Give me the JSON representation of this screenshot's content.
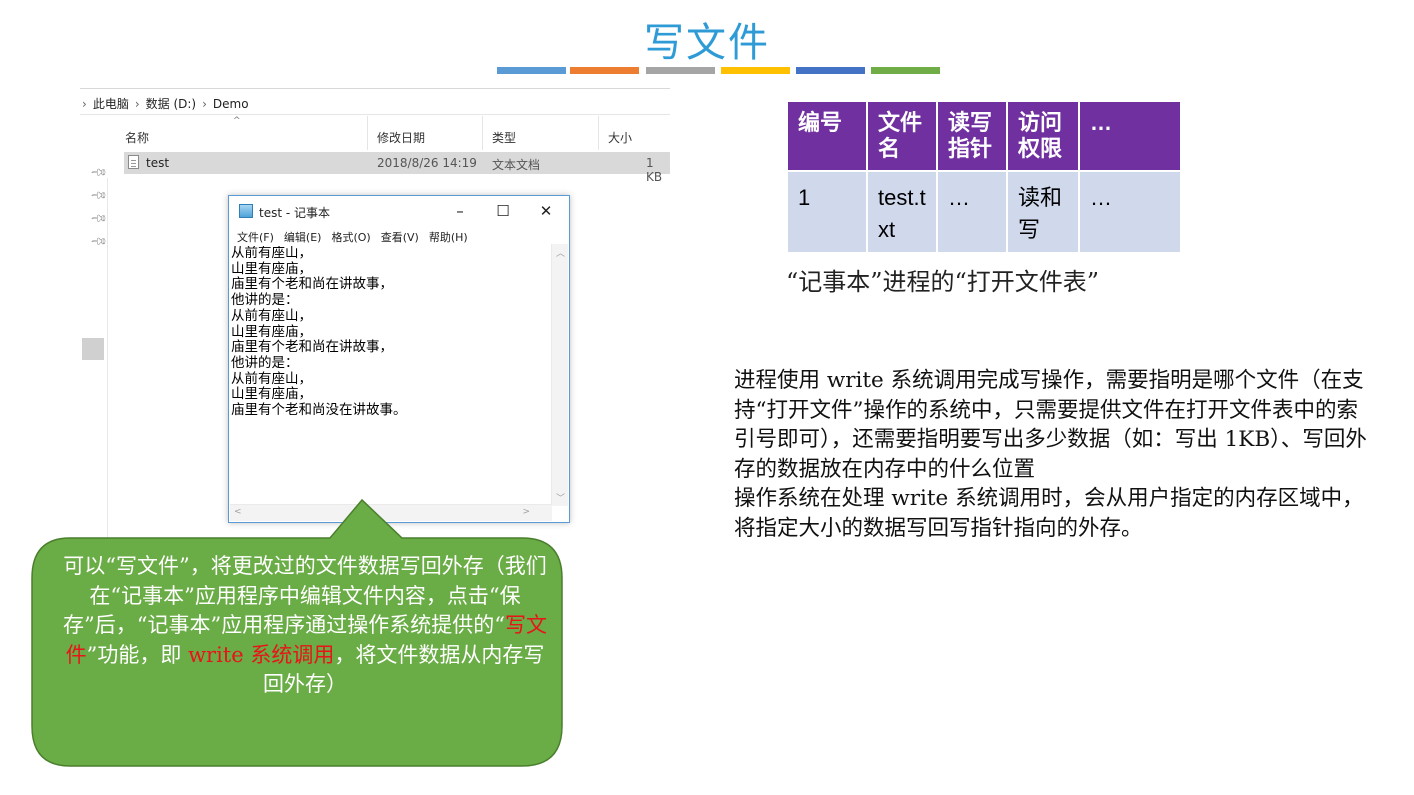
{
  "slide": {
    "title": "写文件",
    "deco_colors": [
      "#5b9bd5",
      "#ed7d31",
      "#a5a5a5",
      "#ffc000",
      "#4472c4",
      "#70ad47"
    ]
  },
  "explorer": {
    "breadcrumb": [
      "此电脑",
      "数据 (D:)",
      "Demo"
    ],
    "columns": {
      "name": "名称",
      "modified": "修改日期",
      "type": "类型",
      "size": "大小"
    },
    "file": {
      "name": "test",
      "modified": "2018/8/26 14:19",
      "type": "文本文档",
      "size": "1 KB"
    }
  },
  "notepad": {
    "title": "test - 记事本",
    "menu": [
      "文件(F)",
      "编辑(E)",
      "格式(O)",
      "查看(V)",
      "帮助(H)"
    ],
    "content": "从前有座山，\n山里有座庙，\n庙里有个老和尚在讲故事，\n他讲的是：\n从前有座山，\n山里有座庙，\n庙里有个老和尚在讲故事，\n他讲的是：\n从前有座山，\n山里有座庙，\n庙里有个老和尚没在讲故事。"
  },
  "callout": {
    "part1": "可以“写文件”，将更改过的文件数据写回外存（我们在“记事本”应用程序中编辑文件内容，点击“保存”后，“记事本”应用程序通过操作系统提供的“",
    "highlight1": "写文件",
    "part2": "”功能，即 ",
    "highlight2": "write 系统调用",
    "part3": "，将文件数据从内存写回外存）",
    "fill_color": "#6aac45",
    "highlight_color": "#e8141a"
  },
  "open_file_table": {
    "headers": [
      "编号",
      "文件名",
      "读写指针",
      "访问权限",
      "…"
    ],
    "rows": [
      [
        "1",
        "test.txt",
        "…",
        "读和写",
        "…"
      ]
    ],
    "caption": "“记事本”进程的“打开文件表”",
    "header_color": "#7030a0",
    "cell_color": "#d0d8ec"
  },
  "body": {
    "p1": "进程使用 write 系统调用完成写操作，需要指明是哪个文件（在支持“打开文件”操作的系统中，只需要提供文件在打开文件表中的索引号即可），还需要指明要写出多少数据（如：写出 1KB）、写回外存的数据放在内存中的什么位置",
    "p2": "操作系统在处理 write 系统调用时，会从用户指定的内存区域中，将指定大小的数据写回写指针指向的外存。"
  }
}
